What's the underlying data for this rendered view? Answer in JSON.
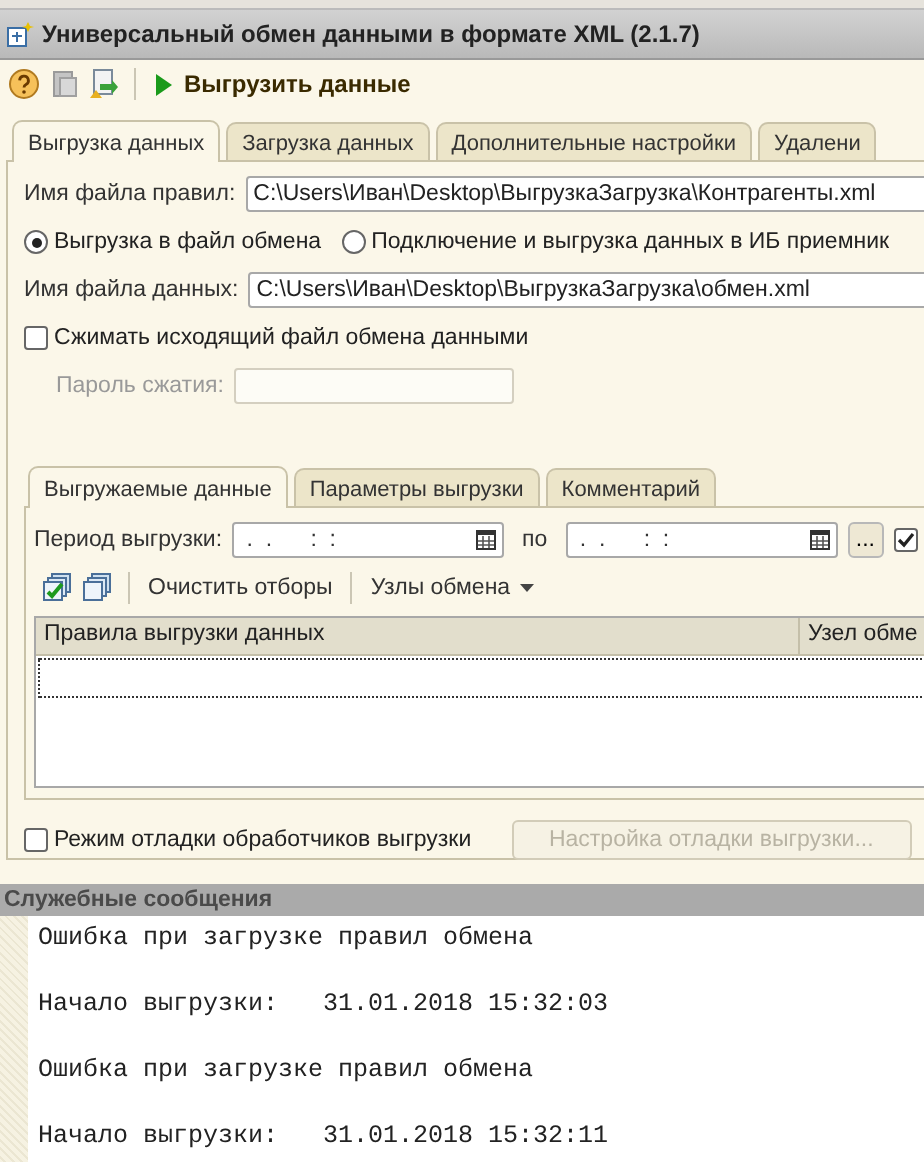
{
  "window": {
    "title": "Универсальный обмен данными в формате XML (2.1.7)"
  },
  "toolbar": {
    "export_button": "Выгрузить данные"
  },
  "tabs": [
    {
      "label": "Выгрузка данных",
      "selected": true
    },
    {
      "label": "Загрузка данных",
      "selected": false
    },
    {
      "label": "Дополнительные настройки",
      "selected": false
    },
    {
      "label": "Удалени",
      "selected": false
    }
  ],
  "rules_file": {
    "label": "Имя файла правил:",
    "value": "C:\\Users\\Иван\\Desktop\\ВыгрузкаЗагрузка\\Контрагенты.xml"
  },
  "mode_radios": [
    {
      "label": "Выгрузка в файл обмена",
      "selected": true
    },
    {
      "label": "Подключение и выгрузка данных в ИБ приемник",
      "selected": false
    }
  ],
  "data_file": {
    "label": "Имя файла данных:",
    "value": "C:\\Users\\Иван\\Desktop\\ВыгрузкаЗагрузка\\обмен.xml"
  },
  "compress": {
    "label": "Сжимать исходящий файл обмена данными",
    "checked": false
  },
  "password": {
    "label": "Пароль сжатия:",
    "disabled": true
  },
  "inner_tabs": [
    {
      "label": "Выгружаемые данные",
      "selected": true
    },
    {
      "label": "Параметры выгрузки",
      "selected": false
    },
    {
      "label": "Комментарий",
      "selected": false
    }
  ],
  "period": {
    "label": "Период выгрузки:",
    "from": " .  .      :  :",
    "to_label": "по",
    "to": " .  .      :  :",
    "select_button": "...",
    "checked": true
  },
  "table_toolbar": {
    "clear_button": "Очистить отборы",
    "nodes_menu": "Узлы обмена"
  },
  "table": {
    "columns": [
      "Правила выгрузки данных",
      "Узел обме"
    ]
  },
  "debug": {
    "label": "Режим отладки обработчиков выгрузки",
    "checked": false,
    "button": "Настройка отладки выгрузки...",
    "button_disabled": true
  },
  "messages": {
    "title": "Служебные сообщения",
    "lines": [
      "Ошибка при загрузке правил обмена",
      "Начало выгрузки:   31.01.2018 15:32:03",
      "Ошибка при загрузке правил обмена",
      "Начало выгрузки:   31.01.2018 15:32:11"
    ]
  }
}
